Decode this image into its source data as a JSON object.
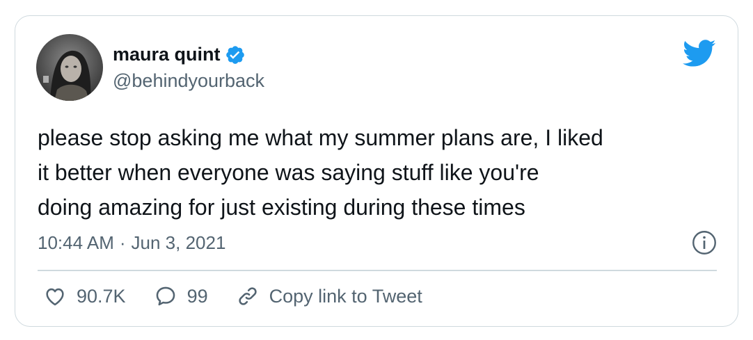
{
  "author": {
    "display_name": "maura quint",
    "handle": "@behindyourback",
    "verified": true
  },
  "tweet": {
    "text": "please stop asking me what my summer plans are, I liked\nit better when everyone was saying stuff like you're\ndoing amazing for just existing during these times",
    "time": "10:44 AM",
    "separator": "·",
    "date": "Jun 3, 2021"
  },
  "actions": {
    "likes": "90.7K",
    "replies": "99",
    "copy_link": "Copy link to Tweet"
  },
  "icons": {
    "logo": "twitter-bird-icon",
    "verified": "verified-badge-icon",
    "info": "info-icon",
    "like": "heart-icon",
    "reply": "reply-bubble-icon",
    "link": "link-icon"
  },
  "colors": {
    "brand": "#1d9bf0",
    "text": "#0f1419",
    "secondary": "#536471",
    "border": "#cfd9de"
  }
}
